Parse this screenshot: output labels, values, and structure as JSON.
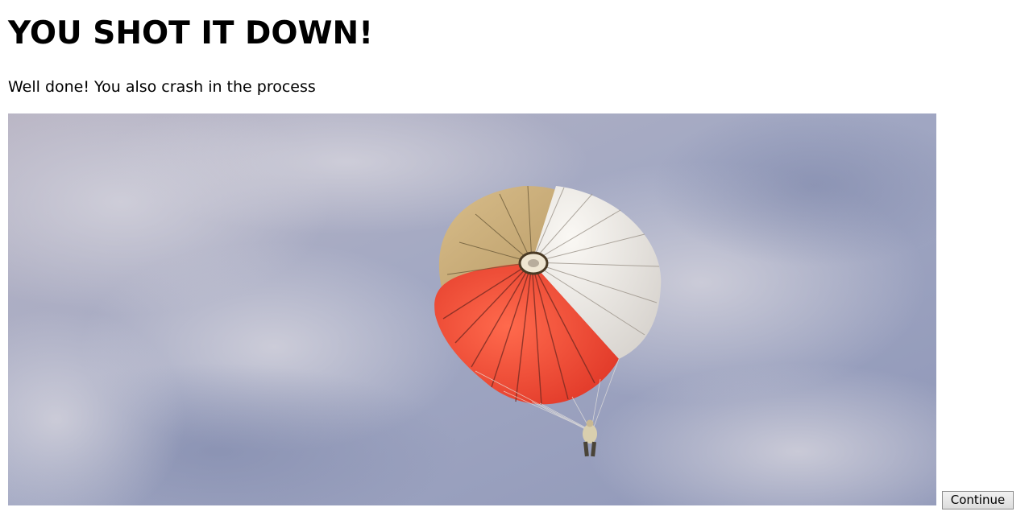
{
  "heading": "YOU SHOT IT DOWN!",
  "message": "Well done! You also crash in the process",
  "image": {
    "subject": "parachute descending in cloudy sky",
    "sky_color": "#9ea6c2",
    "canopy_colors": [
      "#f04a35",
      "#f3efe9",
      "#cfb07a"
    ]
  },
  "continue_button": {
    "label": "Continue"
  }
}
